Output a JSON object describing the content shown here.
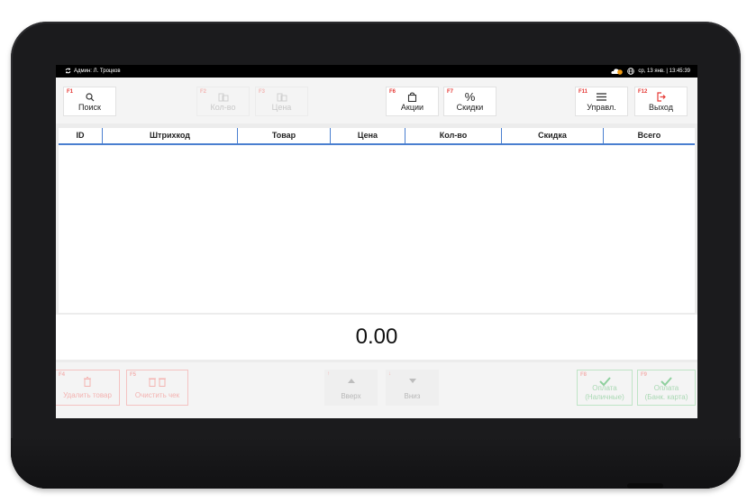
{
  "status": {
    "user_label": "Админ: Л. Троцков",
    "datetime": "ср, 13 янв. | 13:45:39"
  },
  "toolbar": {
    "buttons": [
      {
        "key": "F1",
        "label": "Поиск",
        "icon": "search-icon",
        "enabled": true
      },
      {
        "key": "F2",
        "label": "Кол-во",
        "icon": "quantity-icon",
        "enabled": false
      },
      {
        "key": "F3",
        "label": "Цена",
        "icon": "price-icon",
        "enabled": false
      },
      {
        "key": "F6",
        "label": "Акции",
        "icon": "bag-icon",
        "enabled": true
      },
      {
        "key": "F7",
        "label": "Скидки",
        "icon": "percent-icon",
        "enabled": true
      },
      {
        "key": "F11",
        "label": "Управл.",
        "icon": "menu-icon",
        "enabled": true
      },
      {
        "key": "F12",
        "label": "Выход",
        "icon": "exit-icon",
        "enabled": true
      }
    ]
  },
  "table": {
    "columns": [
      "ID",
      "Штрихкод",
      "Товар",
      "Цена",
      "Кол-во",
      "Скидка",
      "Всего"
    ],
    "rows": []
  },
  "total": "0.00",
  "bottom": {
    "buttons": [
      {
        "key": "F4",
        "label": "Удалить товар",
        "icon": "trash-icon"
      },
      {
        "key": "F5",
        "label": "Очистить чек",
        "icon": "double-trash-icon"
      },
      {
        "key": "↑",
        "label": "Вверх",
        "icon": "arrow-up-icon"
      },
      {
        "key": "↓",
        "label": "Вниз",
        "icon": "arrow-down-icon"
      },
      {
        "key": "F8",
        "label_line1": "Оплата",
        "label_line2": "(Наличные)",
        "icon": "check-icon"
      },
      {
        "key": "F9",
        "label_line1": "Оплата",
        "label_line2": "(Банк. карта)",
        "icon": "check-icon"
      }
    ]
  },
  "colors": {
    "accent_blue": "#4a7fd0",
    "fkey_red": "#e53935",
    "pay_green": "#5cb85c"
  }
}
